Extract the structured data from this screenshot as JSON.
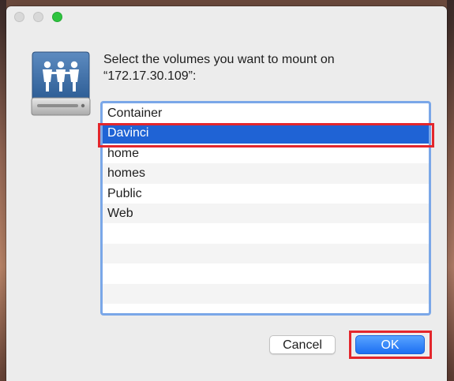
{
  "window": {
    "traffic_lights": {
      "close_color": "#d8d8d8",
      "minimize_color": "#d8d8d8",
      "zoom_color": "#2ec43f"
    }
  },
  "dialog": {
    "icon": "network-volume-icon",
    "prompt_line1": "Select the volumes you want to mount on",
    "prompt_line2": "“172.17.30.109”:",
    "volumes": [
      {
        "label": "Container",
        "selected": false
      },
      {
        "label": "Davinci",
        "selected": true
      },
      {
        "label": "home",
        "selected": false
      },
      {
        "label": "homes",
        "selected": false
      },
      {
        "label": "Public",
        "selected": false
      },
      {
        "label": "Web",
        "selected": false
      }
    ],
    "cancel_label": "Cancel",
    "ok_label": "OK"
  },
  "colors": {
    "selection": "#1f63d5",
    "accent_button": "#1d6ff2",
    "annotation_box": "#e3262c"
  }
}
